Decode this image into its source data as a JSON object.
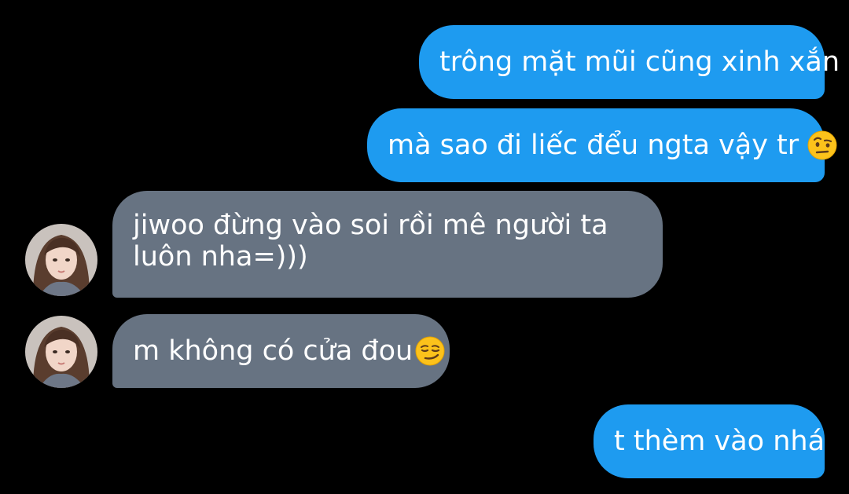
{
  "messages": [
    {
      "side": "sent",
      "text": "trông mặt mũi cũng xinh xắn"
    },
    {
      "side": "sent",
      "text": "mà sao đi liếc đểu ngta vậy tr",
      "emoji": "raised-eyebrow-face-icon"
    },
    {
      "side": "received",
      "text": "jiwoo đừng vào soi rồi mê người ta luôn nha=)))"
    },
    {
      "side": "received",
      "text": "m không có cửa đou",
      "emoji": "smirking-face-icon"
    },
    {
      "side": "sent",
      "text": "t thèm vào nhá"
    }
  ],
  "colors": {
    "background": "#000000",
    "sent_bubble": "#1e9bf0",
    "received_bubble": "#677382",
    "text": "#ffffff"
  }
}
